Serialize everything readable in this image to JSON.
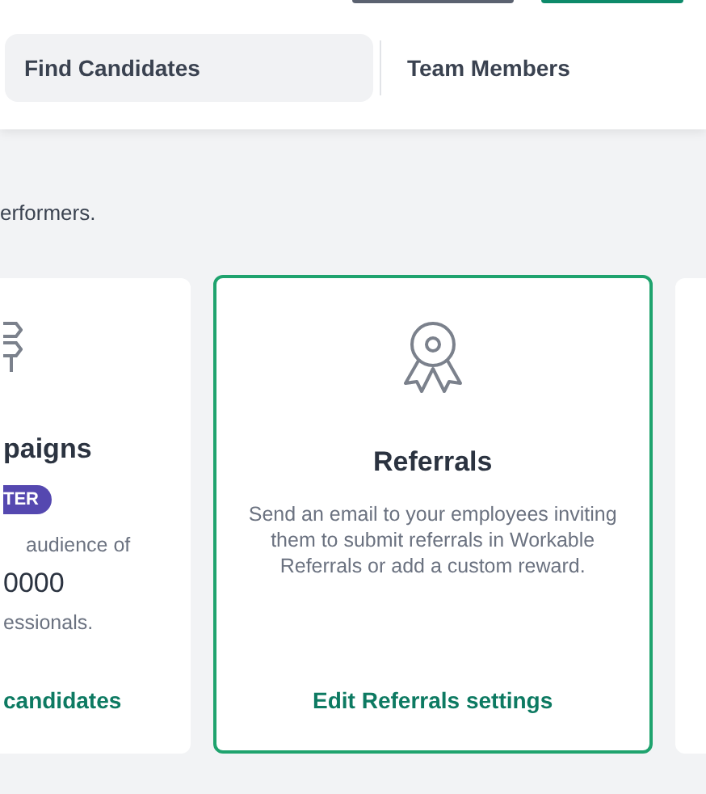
{
  "header": {
    "buttons": [
      {
        "kind": "secondary"
      },
      {
        "kind": "primary"
      }
    ],
    "tabs": [
      {
        "label": "Find Candidates",
        "selected": true
      },
      {
        "label": "Team Members",
        "selected": false
      }
    ]
  },
  "intro": "erformers.",
  "cards": [
    {
      "kind": "partial",
      "title": "paigns",
      "badge": "TER",
      "lines": [
        "audience of",
        "0000",
        "essionals."
      ],
      "link": "candidates",
      "selected": false
    },
    {
      "kind": "full",
      "title": "Referrals",
      "lines": [
        "Send an email to your employees inviting them to submit referrals in Workable Referrals or add a custom reward."
      ],
      "link": "Edit Referrals settings",
      "selected": true
    }
  ]
}
